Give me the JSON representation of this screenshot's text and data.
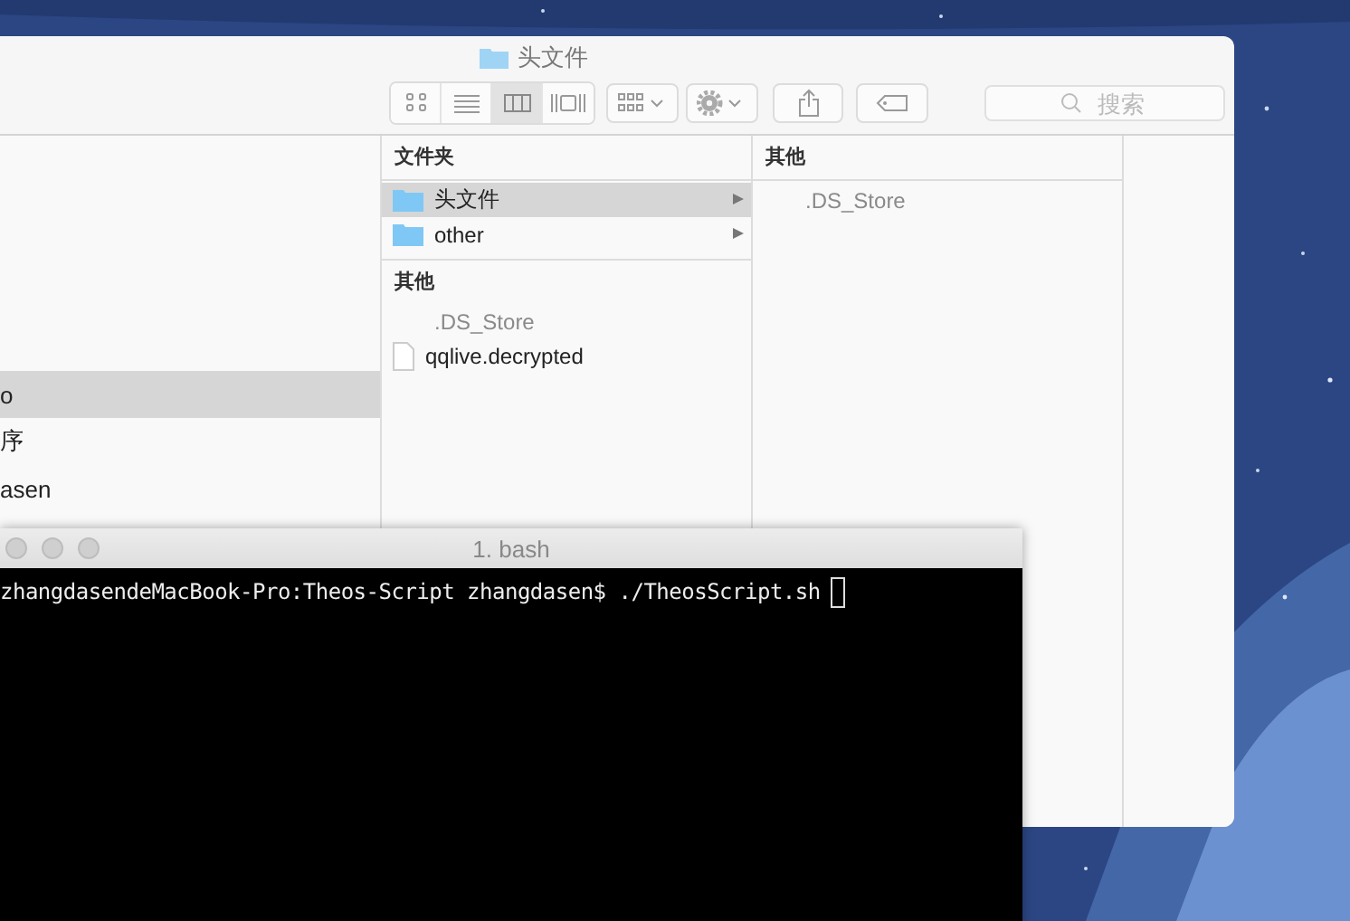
{
  "finder": {
    "title": "头文件",
    "view_buttons": [
      {
        "kind": "icons",
        "selected": false
      },
      {
        "kind": "list",
        "selected": false
      },
      {
        "kind": "columns",
        "selected": true
      },
      {
        "kind": "gallery",
        "selected": false
      }
    ],
    "search": {
      "placeholder": "搜索"
    },
    "columns": [
      {
        "sections": [
          {
            "items": [
              {
                "name": "o",
                "kind": "plain",
                "selected": true
              },
              {
                "name": "序",
                "kind": "plain",
                "selected": false
              },
              {
                "name": "asen",
                "kind": "plain",
                "selected": false
              }
            ]
          }
        ]
      },
      {
        "sections": [
          {
            "header": "文件夹",
            "items": [
              {
                "name": "头文件",
                "kind": "folder",
                "selected": true
              },
              {
                "name": "other",
                "kind": "folder",
                "selected": false
              }
            ]
          },
          {
            "header": "其他",
            "items": [
              {
                "name": ".DS_Store",
                "kind": "hidden",
                "selected": false
              },
              {
                "name": "qqlive.decrypted",
                "kind": "file",
                "selected": false
              }
            ]
          }
        ]
      },
      {
        "sections": [
          {
            "header": "其他",
            "items": [
              {
                "name": ".DS_Store",
                "kind": "hidden",
                "selected": false
              }
            ]
          }
        ]
      }
    ]
  },
  "terminal": {
    "title": "1. bash",
    "lines": [
      {
        "prompt": "zhangdasendeMacBook-Pro:Theos-Script zhangdasen$",
        "command": "./TheosScript.sh",
        "cursor": true
      }
    ]
  }
}
